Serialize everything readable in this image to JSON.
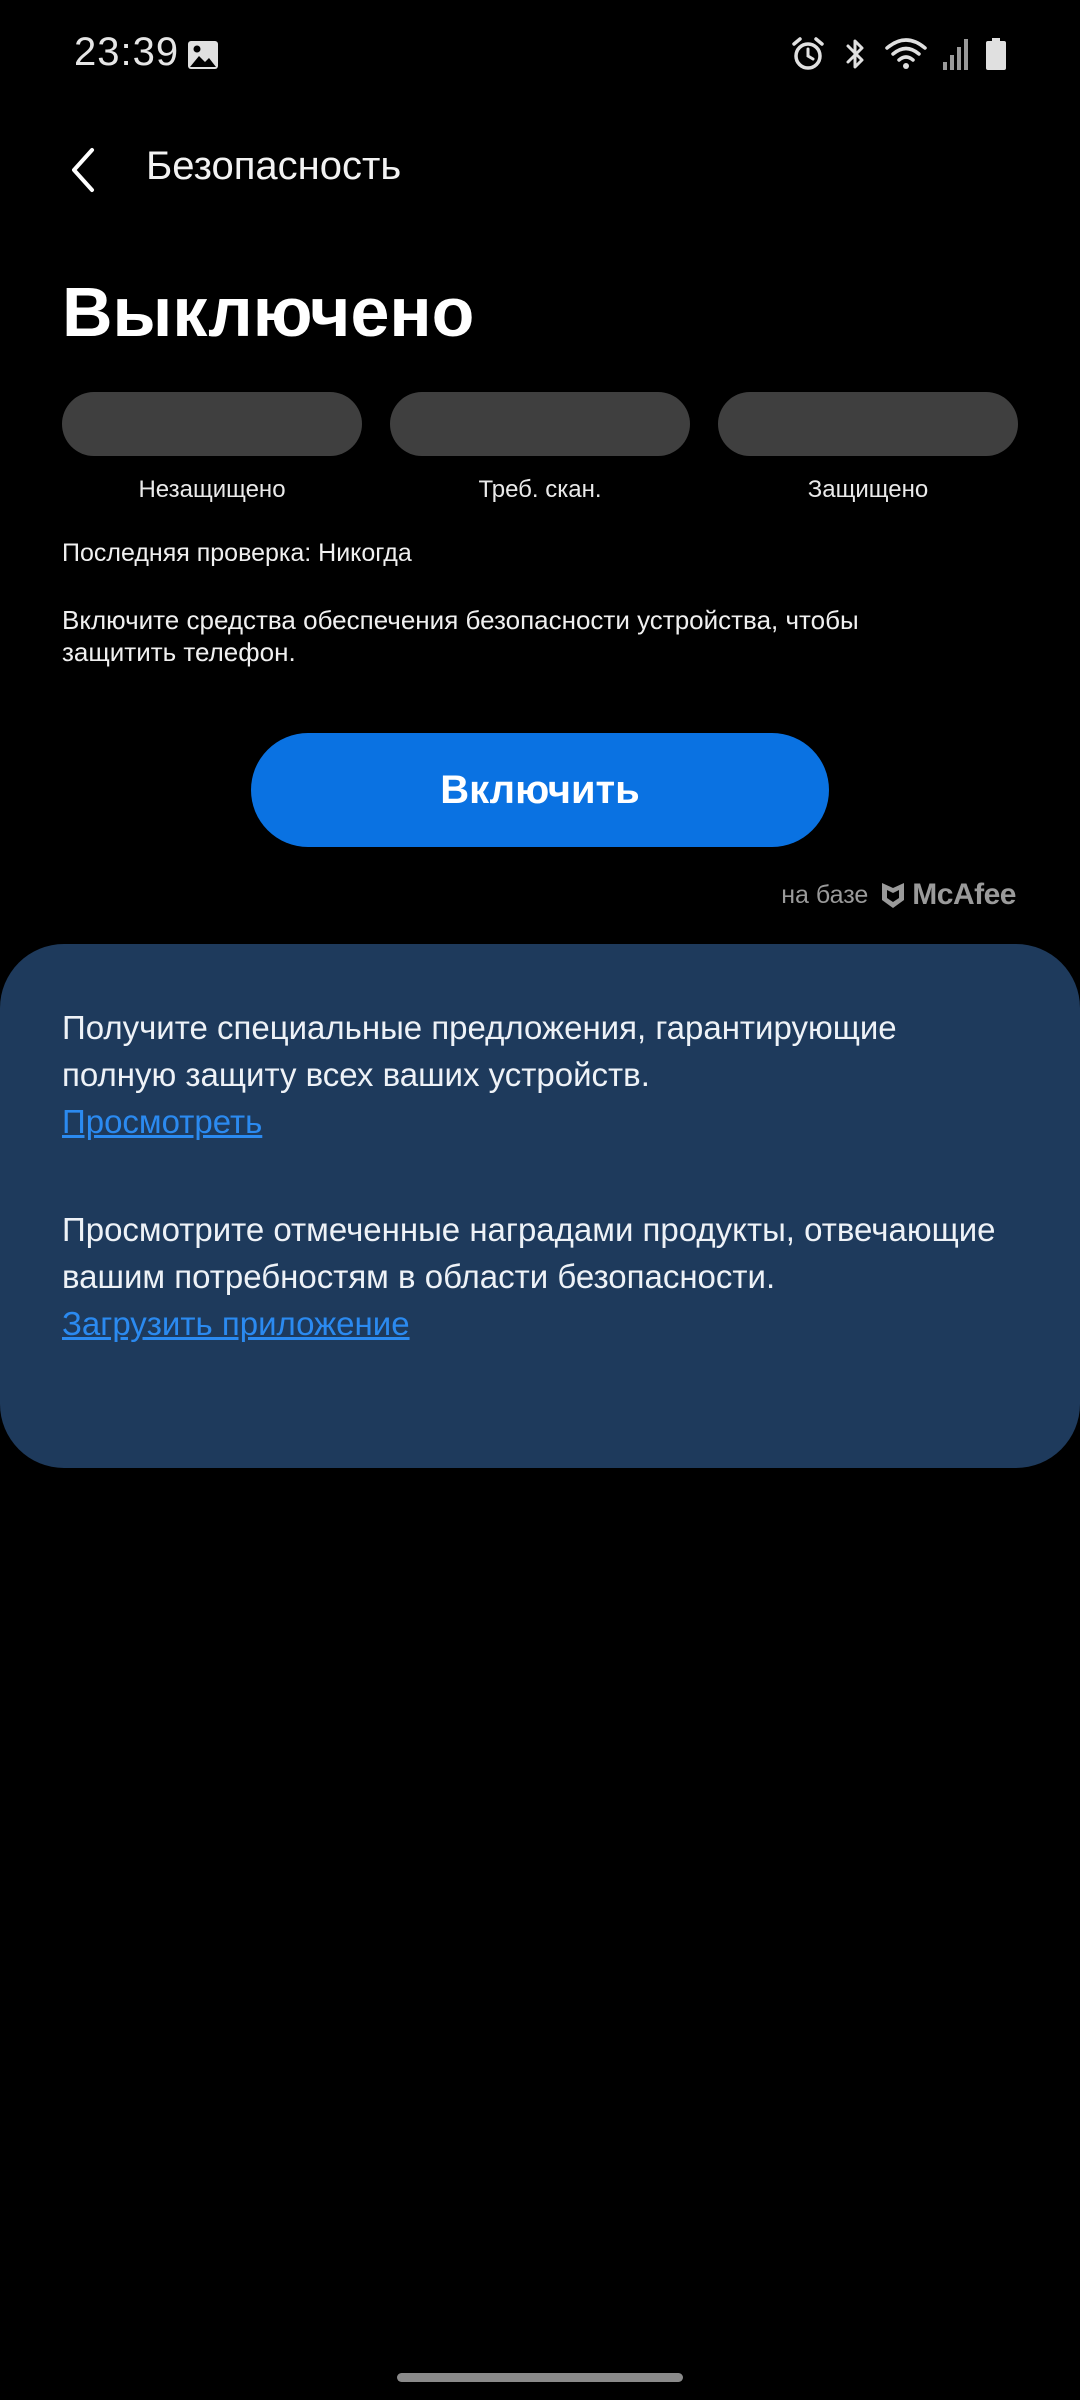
{
  "status_bar": {
    "time": "23:39",
    "icons": [
      "gallery-icon",
      "alarm-icon",
      "bluetooth-icon",
      "wifi-icon",
      "signal-icon",
      "battery-icon"
    ]
  },
  "header": {
    "title": "Безопасность",
    "back_icon": "chevron-left-icon"
  },
  "status": {
    "state": "Выключено",
    "indicators": [
      {
        "label": "Незащищено"
      },
      {
        "label": "Треб. скан."
      },
      {
        "label": "Защищено"
      }
    ],
    "last_check": "Последняя проверка: Никогда",
    "description": "Включите средства обеспечения безопасности устройства, чтобы защитить телефон."
  },
  "actions": {
    "enable_label": "Включить",
    "button_color": "#0a72e2"
  },
  "powered_by": {
    "text": "на базе",
    "brand": "McAfee"
  },
  "offers": {
    "background_color": "#1e3a5c",
    "items": [
      {
        "text": "Получите специальные предложения, гарантирующие полную защиту всех ваших устройств.",
        "link": "Просмотреть"
      },
      {
        "text": "Просмотрите отмеченные наградами продукты, отвечающие вашим потребностям в области безопасности.",
        "link": "Загрузить приложение"
      }
    ]
  }
}
